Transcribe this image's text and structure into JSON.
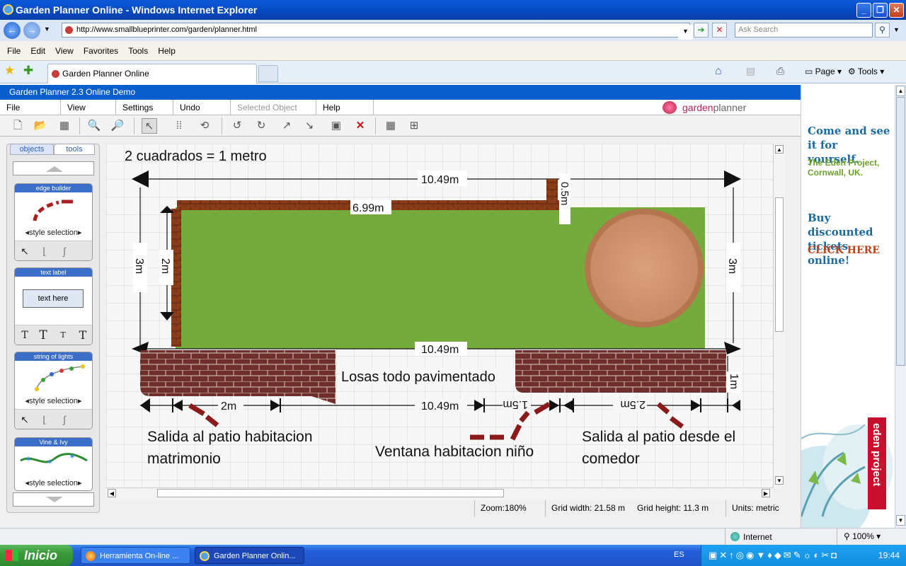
{
  "browser": {
    "window_title": "Garden Planner Online - Windows Internet Explorer",
    "url": "http://www.smallblueprinter.com/garden/planner.html",
    "search_placeholder": "Ask Search",
    "menu": [
      "File",
      "Edit",
      "View",
      "Favorites",
      "Tools",
      "Help"
    ],
    "tab_title": "Garden Planner Online",
    "command_bar": {
      "page": "Page",
      "tools": "Tools"
    },
    "status_zone": "Internet",
    "status_zoom": "100%"
  },
  "app": {
    "title": "Garden Planner 2.3 Online Demo",
    "menu": [
      "File",
      "View",
      "Settings",
      "Undo",
      "Selected Object",
      "Help"
    ],
    "logo_text_a": "garden",
    "logo_text_b": "planner",
    "panel_tabs": [
      "objects",
      "tools"
    ],
    "tools": [
      {
        "title": "edge builder",
        "selector": "style selection"
      },
      {
        "title": "text label",
        "sample": "text here"
      },
      {
        "title": "string of lights",
        "selector": "style selection"
      },
      {
        "title": "Vine & Ivy",
        "selector": "style selection"
      }
    ],
    "status": {
      "zoom": "Zoom:180%",
      "grid_width": "Grid width: 21.58 m",
      "grid_height": "Grid height: 11.3 m",
      "units": "Units: metric"
    }
  },
  "plan": {
    "scale_note": "2 cuadrados = 1 metro",
    "dims": {
      "top": "10.49m",
      "wall": "6.99m",
      "post": "0.5m",
      "left_outer": "3m",
      "left_inner": "2m",
      "right": "3m",
      "middle": "10.49m",
      "bottom": "10.49m",
      "b1": "2m",
      "b2": "1.5m",
      "b3": "2.5m",
      "side": "1m"
    },
    "paving_label": "Losas todo pavimentado",
    "note_left": "Salida al patio habitacion matrimonio",
    "note_center": "Ventana habitacion niño",
    "note_right": "Salida al patio desde el comedor"
  },
  "ad": {
    "headline1": "Come and see it for yourself.",
    "sub": "The Eden Project, Cornwall, UK.",
    "headline2": "Buy discounted tickets online!",
    "cta": "CLICK HERE",
    "brand": "eden project"
  },
  "taskbar": {
    "start": "Inicio",
    "tasks": [
      "Herramienta On-line ...",
      "Garden Planner Onlin..."
    ],
    "lang": "ES",
    "clock": "19:44"
  },
  "colors": {
    "lawn": "#74ab3c",
    "brick_wall": "#8a3b18",
    "paving": "#6e2f2c",
    "pot": "#d39872",
    "accent_blue": "#0a5fcc",
    "ad_red": "#c8102e"
  }
}
